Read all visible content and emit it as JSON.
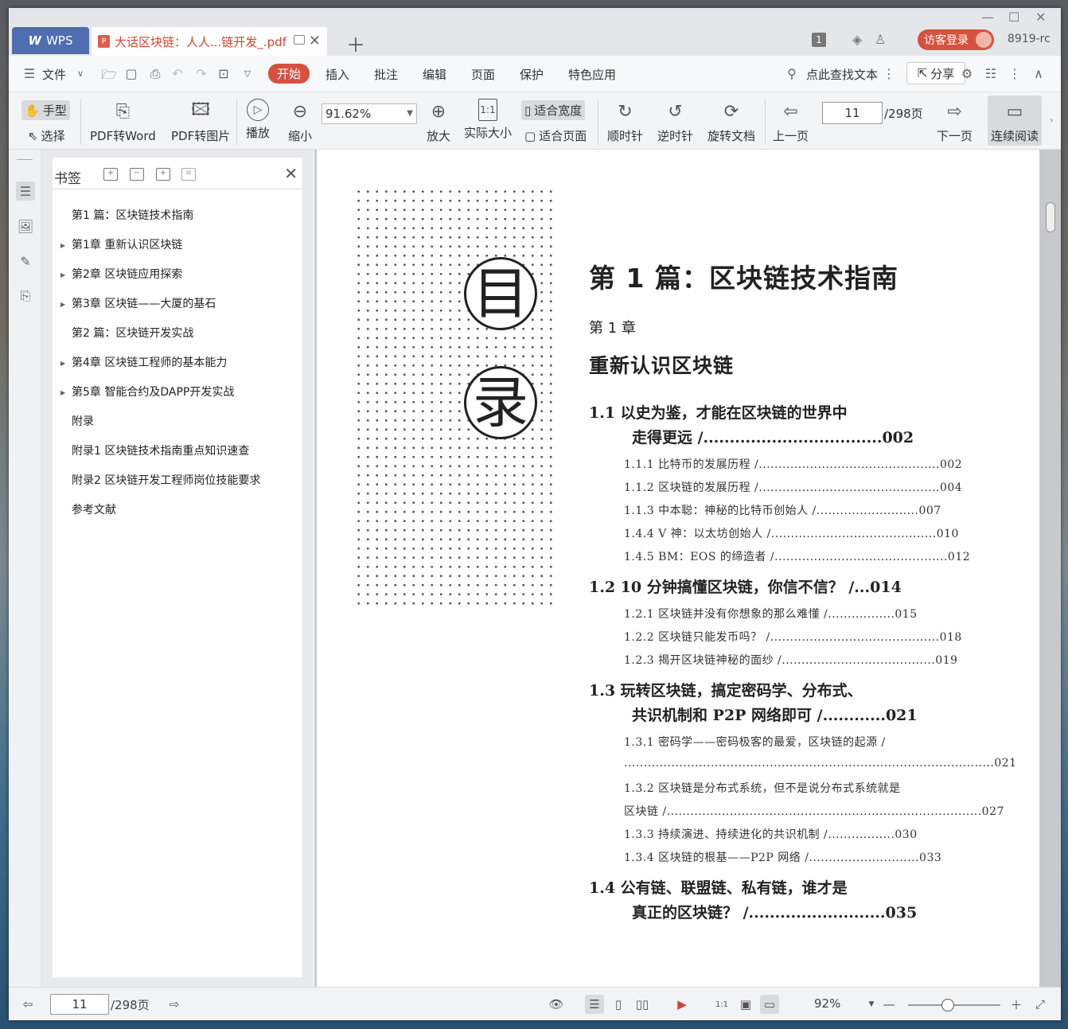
{
  "app": {
    "name": "WPS",
    "document_tab": "大话区块链：人人...链开发_.pdf",
    "tab_count": "1",
    "login_label": "访客登录",
    "user_id": "8919-rc"
  },
  "menu": {
    "file": "文件",
    "tabs": [
      "开始",
      "插入",
      "批注",
      "编辑",
      "页面",
      "保护",
      "特色应用"
    ],
    "active_tab": "开始",
    "search_placeholder": "点此查找文本",
    "share": "分享"
  },
  "toolbar": {
    "hand": "手型",
    "select": "选择",
    "pdf_to_word": "PDF转Word",
    "pdf_to_image": "PDF转图片",
    "play": "播放",
    "zoom_out": "缩小",
    "zoom_value": "91.62%",
    "zoom_in": "放大",
    "actual_size": "实际大小",
    "fit_width": "适合宽度",
    "fit_page": "适合页面",
    "clockwise": "顺时针",
    "counterclockwise": "逆时针",
    "rotate_doc": "旋转文档",
    "prev_page": "上一页",
    "current_page": "11",
    "total_pages": "/298页",
    "next_page": "下一页",
    "continuous": "连续阅读"
  },
  "bookmarks": {
    "title": "书签",
    "items": [
      {
        "label": "第1 篇：区块链技术指南",
        "expandable": false
      },
      {
        "label": "第1章 重新认识区块链",
        "expandable": true
      },
      {
        "label": "第2章 区块链应用探索",
        "expandable": true
      },
      {
        "label": "第3章 区块链——大厦的基石",
        "expandable": true
      },
      {
        "label": "第2 篇：区块链开发实战",
        "expandable": false
      },
      {
        "label": "第4章 区块链工程师的基本能力",
        "expandable": true
      },
      {
        "label": "第5章 智能合约及DAPP开发实战",
        "expandable": true
      },
      {
        "label": "附录",
        "expandable": false
      },
      {
        "label": "附录1 区块链技术指南重点知识速查",
        "expandable": false
      },
      {
        "label": "附录2 区块链开发工程师岗位技能要求",
        "expandable": false
      },
      {
        "label": "参考文献",
        "expandable": false
      }
    ]
  },
  "page_content": {
    "mu": "目",
    "lu": "录",
    "part_title": "第 1 篇：区块链技术指南",
    "chapter_no": "第 1 章",
    "chapter_title": "重新认识区块链",
    "s11a": "1.1   以史为鉴，才能在区块链的世界中",
    "s11b": "走得更远 /..................................002",
    "s111": "1.1.1   比特币的发展历程 /..............................................002",
    "s112": "1.1.2   区块链的发展历程 /..............................................004",
    "s113": "1.1.3   中本聪：神秘的比特币创始人 /..........................007",
    "s114": "1.4.4   V 神：以太坊创始人 /..........................................010",
    "s115": "1.4.5   BM：EOS 的缔造者 /............................................012",
    "s12": "1.2   10 分钟搞懂区块链，你信不信？ /...014",
    "s121": "1.2.1   区块链并没有你想象的那么难懂 /.................015",
    "s122": "1.2.2   区块链只能发币吗？ /...........................................018",
    "s123": "1.2.3   揭开区块链神秘的面纱 /.......................................019",
    "s13a": "1.3   玩转区块链，搞定密码学、分布式、",
    "s13b": "共识机制和 P2P 网络即可 /............021",
    "s131a": "1.3.1   密码学——密码极客的最爱，区块链的起源 /",
    "s131b": "..............................................................................................021",
    "s132a": "1.3.2   区块链是分布式系统，但不是说分布式系统就是",
    "s132b": "区块链 /................................................................................027",
    "s133": "1.3.3   持续演进、持续进化的共识机制 /.................030",
    "s134": "1.3.4   区块链的根基——P2P 网络 /............................033",
    "s14a": "1.4   公有链、联盟链、私有链，谁才是",
    "s14b": "真正的区块链？ /..........................035"
  },
  "status": {
    "current_page": "11",
    "total_pages": "/298页",
    "zoom_percent": "92%"
  },
  "colors": {
    "accent": "#d5523e",
    "wps_blue": "#4f6db0"
  }
}
